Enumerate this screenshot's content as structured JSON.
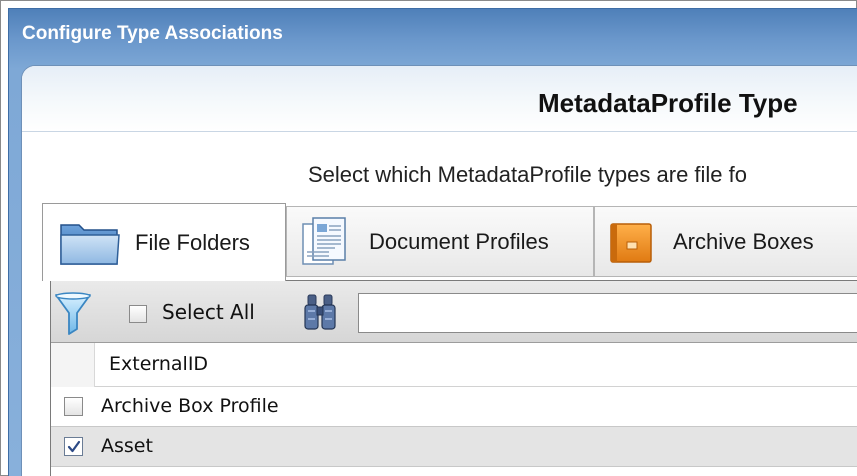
{
  "window": {
    "title": "Configure Type Associations"
  },
  "header": {
    "title": "MetadataProfile Type",
    "subtitle": "Select which MetadataProfile types are file fo"
  },
  "tabs": [
    {
      "label": "File Folders",
      "icon": "folder-icon",
      "active": true
    },
    {
      "label": "Document Profiles",
      "icon": "document-icon",
      "active": false
    },
    {
      "label": "Archive Boxes",
      "icon": "archive-box-icon",
      "active": false
    }
  ],
  "toolbar": {
    "filter_icon": "filter-icon",
    "select_all_label": "Select All",
    "select_all_checked": false,
    "search_icon": "binoculars-icon",
    "search_value": ""
  },
  "grid": {
    "column_header": "ExternalID",
    "rows": [
      {
        "label": "Archive Box Profile",
        "checked": false
      },
      {
        "label": "Asset",
        "checked": true
      }
    ]
  },
  "colors": {
    "titlebar": "#4f80b9",
    "archive_box_orange": "#f08a1e",
    "folder_blue": "#3f78b8"
  }
}
